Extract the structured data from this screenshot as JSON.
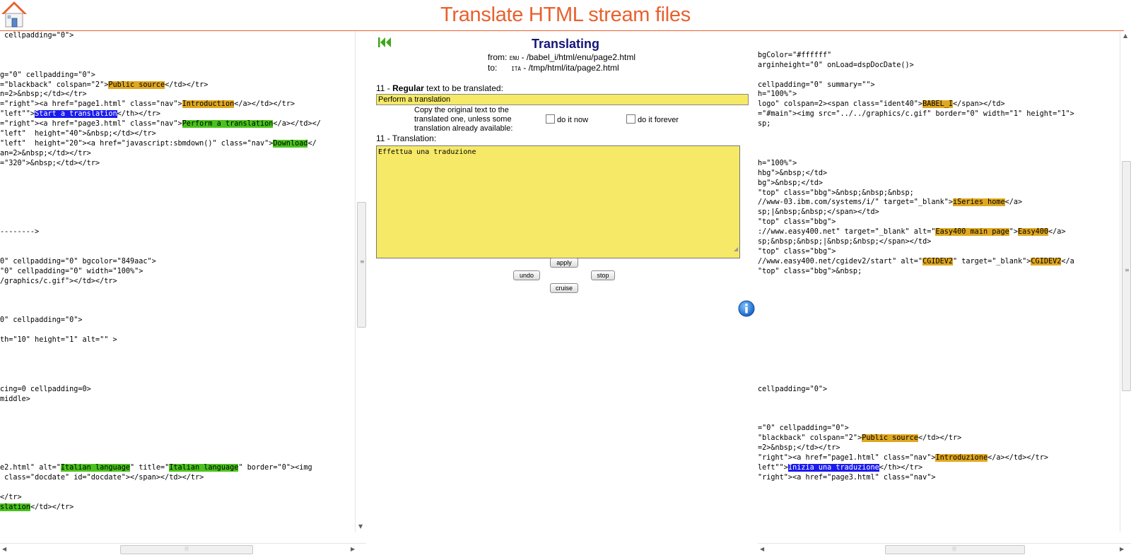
{
  "header": {
    "title": "Translate HTML stream files"
  },
  "left_pane": {
    "lines": [
      [
        {
          "t": " cellpadding=\"0\">"
        }
      ],
      [
        {
          "t": ""
        }
      ],
      [
        {
          "t": ""
        }
      ],
      [
        {
          "t": ""
        }
      ],
      [
        {
          "t": "g=\"0\" cellpadding=\"0\">"
        }
      ],
      [
        {
          "t": "=\"blackback\" colspan=\"2\">"
        },
        {
          "t": "Public source",
          "hl": "orange"
        },
        {
          "t": "</td></tr>"
        }
      ],
      [
        {
          "t": "n=2>&nbsp;</td></tr>"
        }
      ],
      [
        {
          "t": "=\"right\"><a href=\"page1.html\" class=\"nav\">"
        },
        {
          "t": "Introduction",
          "hl": "orange"
        },
        {
          "t": "</a></td></tr>"
        }
      ],
      [
        {
          "t": "\"left\"\">"
        },
        {
          "t": "Start a translation",
          "hl": "blue"
        },
        {
          "t": "</th></tr>"
        }
      ],
      [
        {
          "t": "=\"right\"><a href=\"page3.html\" class=\"nav\">"
        },
        {
          "t": "Perform a translation",
          "hl": "green"
        },
        {
          "t": "</a></td></"
        }
      ],
      [
        {
          "t": "\"left\"  height=\"40\">&nbsp;</td></tr>"
        }
      ],
      [
        {
          "t": "\"left\"  height=\"20\"><a href=\"javascript:sbmdown()\" class=\"nav\">"
        },
        {
          "t": "Download",
          "hl": "green"
        },
        {
          "t": "</"
        }
      ],
      [
        {
          "t": "an=2>&nbsp;</td></tr>"
        }
      ],
      [
        {
          "t": "=\"320\">&nbsp;</td></tr>"
        }
      ],
      [
        {
          "t": ""
        }
      ],
      [
        {
          "t": ""
        }
      ],
      [
        {
          "t": ""
        }
      ],
      [
        {
          "t": ""
        }
      ],
      [
        {
          "t": ""
        }
      ],
      [
        {
          "t": ""
        }
      ],
      [
        {
          "t": "-------->"
        }
      ],
      [
        {
          "t": ""
        }
      ],
      [
        {
          "t": ""
        }
      ],
      [
        {
          "t": "0\" cellpadding=\"0\" bgcolor=\"849aac\">"
        }
      ],
      [
        {
          "t": "\"0\" cellpadding=\"0\" width=\"100%\">"
        }
      ],
      [
        {
          "t": "/graphics/c.gif\"></td></tr>"
        }
      ],
      [
        {
          "t": ""
        }
      ],
      [
        {
          "t": ""
        }
      ],
      [
        {
          "t": ""
        }
      ],
      [
        {
          "t": "0\" cellpadding=\"0\">"
        }
      ],
      [
        {
          "t": ""
        }
      ],
      [
        {
          "t": "th=\"10\" height=\"1\" alt=\"\" >"
        }
      ],
      [
        {
          "t": ""
        }
      ],
      [
        {
          "t": ""
        }
      ],
      [
        {
          "t": ""
        }
      ],
      [
        {
          "t": ""
        }
      ],
      [
        {
          "t": "cing=0 cellpadding=0>"
        }
      ],
      [
        {
          "t": "middle>"
        }
      ],
      [
        {
          "t": ""
        }
      ],
      [
        {
          "t": ""
        }
      ],
      [
        {
          "t": ""
        }
      ],
      [
        {
          "t": ""
        }
      ],
      [
        {
          "t": ""
        }
      ],
      [
        {
          "t": ""
        }
      ],
      [
        {
          "t": "e2.html\" alt=\""
        },
        {
          "t": "Italian language",
          "hl": "green"
        },
        {
          "t": "\" title=\""
        },
        {
          "t": "Italian language",
          "hl": "green"
        },
        {
          "t": "\" border=\"0\"><img"
        }
      ],
      [
        {
          "t": " class=\"docdate\" id=\"docdate\"></span></td></tr>"
        }
      ],
      [
        {
          "t": ""
        }
      ],
      [
        {
          "t": "</tr>"
        }
      ],
      [
        {
          "t": "slation",
          "hl": "green"
        },
        {
          "t": "</td></tr>"
        }
      ]
    ]
  },
  "right_pane": {
    "lines": [
      [
        {
          "t": ""
        }
      ],
      [
        {
          "t": ""
        }
      ],
      [
        {
          "t": "bgColor=\"#ffffff\""
        }
      ],
      [
        {
          "t": "arginheight=\"0\" onLoad=dspDocDate()>"
        }
      ],
      [
        {
          "t": ""
        }
      ],
      [
        {
          "t": "cellpadding=\"0\" summary=\"\">"
        }
      ],
      [
        {
          "t": "h=\"100%\">"
        }
      ],
      [
        {
          "t": "logo\" colspan=2><span class=\"ident40\">"
        },
        {
          "t": "BABEL_I",
          "hl": "orange"
        },
        {
          "t": "</span></td>"
        }
      ],
      [
        {
          "t": "=\"#main\"><img src=\"../../graphics/c.gif\" border=\"0\" width=\"1\" height=\"1\">"
        }
      ],
      [
        {
          "t": "sp;"
        }
      ],
      [
        {
          "t": ""
        }
      ],
      [
        {
          "t": ""
        }
      ],
      [
        {
          "t": ""
        }
      ],
      [
        {
          "t": "h=\"100%\">"
        }
      ],
      [
        {
          "t": "hbg\">&nbsp;</td>"
        }
      ],
      [
        {
          "t": "bg\">&nbsp;</td>"
        }
      ],
      [
        {
          "t": "\"top\" class=\"bbg\">&nbsp;&nbsp;&nbsp;"
        }
      ],
      [
        {
          "t": "//www-03.ibm.com/systems/i/\" target=\"_blank\">"
        },
        {
          "t": "iSeries home",
          "hl": "orange"
        },
        {
          "t": "</a>"
        }
      ],
      [
        {
          "t": "sp;|&nbsp;&nbsp;</span></td>"
        }
      ],
      [
        {
          "t": "\"top\" class=\"bbg\">"
        }
      ],
      [
        {
          "t": "://www.easy400.net\" target=\"_blank\" alt=\""
        },
        {
          "t": "Easy400 main page",
          "hl": "orange"
        },
        {
          "t": "\">"
        },
        {
          "t": "Easy400",
          "hl": "orange"
        },
        {
          "t": "</a>"
        }
      ],
      [
        {
          "t": "sp;&nbsp;&nbsp;|&nbsp;&nbsp;</span></td>"
        }
      ],
      [
        {
          "t": "\"top\" class=\"bbg\">"
        }
      ],
      [
        {
          "t": "//www.easy400.net/cgidev2/start\" alt=\""
        },
        {
          "t": "CGIDEV2",
          "hl": "orange"
        },
        {
          "t": "\" target=\"_blank\">"
        },
        {
          "t": "CGIDEV2",
          "hl": "orange"
        },
        {
          "t": "</a"
        }
      ],
      [
        {
          "t": "\"top\" class=\"bbg\">&nbsp;"
        }
      ],
      [
        {
          "t": ""
        }
      ],
      [
        {
          "t": ""
        }
      ],
      [
        {
          "t": ""
        }
      ],
      [
        {
          "t": ""
        }
      ],
      [
        {
          "t": ""
        }
      ],
      [
        {
          "t": ""
        }
      ],
      [
        {
          "t": ""
        }
      ],
      [
        {
          "t": ""
        }
      ],
      [
        {
          "t": ""
        }
      ],
      [
        {
          "t": ""
        }
      ],
      [
        {
          "t": ""
        }
      ],
      [
        {
          "t": "cellpadding=\"0\">"
        }
      ],
      [
        {
          "t": ""
        }
      ],
      [
        {
          "t": ""
        }
      ],
      [
        {
          "t": ""
        }
      ],
      [
        {
          "t": "=\"0\" cellpadding=\"0\">"
        }
      ],
      [
        {
          "t": "\"blackback\" colspan=\"2\">"
        },
        {
          "t": "Public source",
          "hl": "orange"
        },
        {
          "t": "</td></tr>"
        }
      ],
      [
        {
          "t": "=2>&nbsp;</td></tr>"
        }
      ],
      [
        {
          "t": "\"right\"><a href=\"page1.html\" class=\"nav\">"
        },
        {
          "t": "Introduzione",
          "hl": "orange"
        },
        {
          "t": "</a></td></tr>"
        }
      ],
      [
        {
          "t": "left\"\">"
        },
        {
          "t": "Inizia una traduzione",
          "hl": "blue"
        },
        {
          "t": "</th></tr>"
        }
      ],
      [
        {
          "t": "\"right\"><a href=\"page3.html\" class=\"nav\">"
        }
      ]
    ]
  },
  "translate": {
    "title": "Translating",
    "from_label": "from:",
    "from_lang": "ENU",
    "from_path": "- /babel_i/html/enu/page2.html",
    "to_label": "to:",
    "to_lang": "ITA",
    "to_path": "- /tmp/html/ita/page2.html",
    "source_num": "11 -",
    "source_bold": "Regular",
    "source_rest": "text to be translated:",
    "source_text": "Perform a translation",
    "copy_note": "Copy the original text to the translated one, unless some translation already available:",
    "do_it_now": "do it now",
    "do_it_forever": "do it forever",
    "do_it_now_checked": false,
    "do_it_forever_checked": false,
    "translation_label": "11 - Translation:",
    "translation_text": "Effettua una traduzione",
    "buttons": {
      "apply": "apply",
      "undo": "undo",
      "stop": "stop",
      "cruise": "cruise"
    }
  },
  "icons": {
    "home": "home-icon",
    "rewind": "rewind-icon",
    "info": "info-icon",
    "grip": "resize-grip-icon"
  },
  "colors": {
    "title": "#e8612e",
    "heading": "#14147a",
    "field_bg": "#f5e967",
    "hl_orange": "#e0a820",
    "hl_green": "#4ac21c",
    "hl_blue": "#1a1aee"
  }
}
